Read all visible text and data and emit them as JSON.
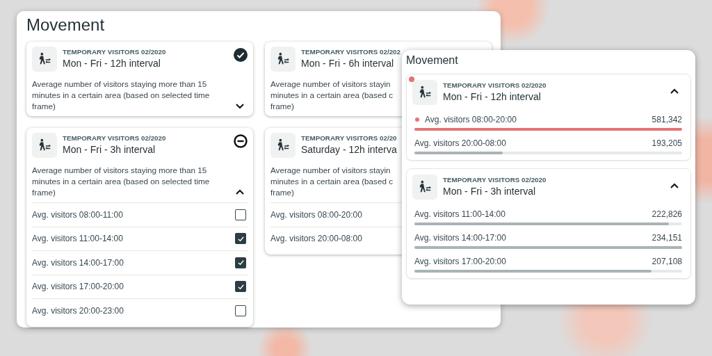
{
  "main_panel": {
    "title": "Movement",
    "columns": [
      [
        {
          "overline": "TEMPORARY VISITORS 02/2020",
          "title": "Mon - Fri - 12h interval",
          "checked": true,
          "description": "Average number of visitors staying more than 15\nminutes in a certain area (based on selected time\nframe)",
          "expanded": false
        },
        {
          "overline": "TEMPORARY VISITORS 02/2020",
          "title": "Mon - Fri - 3h interval",
          "indeterminate": true,
          "description": "Average number of visitors staying more than 15\nminutes in a certain area (based on selected time\nframe)",
          "expanded": true,
          "rows": [
            {
              "label": "Avg. visitors 08:00-11:00",
              "checked": false
            },
            {
              "label": "Avg. visitors 11:00-14:00",
              "checked": true
            },
            {
              "label": "Avg. visitors 14:00-17:00",
              "checked": true
            },
            {
              "label": "Avg. visitors 17:00-20:00",
              "checked": true
            },
            {
              "label": "Avg. visitors 20:00-23:00",
              "checked": false
            }
          ]
        }
      ],
      [
        {
          "overline": "TEMPORARY VISITORS 02/202",
          "title": "Mon - Fri - 6h interval",
          "description": "Average number of visitors stayin\nminutes in a certain area (based c\nframe)"
        },
        {
          "overline": "TEMPORARY VISITORS 02/20",
          "title": "Saturday - 12h interva",
          "description": "Average number of visitors stayin\nminutes in a certain area (based c\nframe)",
          "rows": [
            {
              "label": "Avg. visitors 08:00-20:00"
            },
            {
              "label": "Avg. visitors 20:00-08:00"
            }
          ]
        }
      ]
    ]
  },
  "overlay_panel": {
    "title": "Movement",
    "cards": [
      {
        "overline": "TEMPORARY VISITORS 02/2020",
        "title": "Mon - Fri - 12h interval",
        "color": "#e57373",
        "expanded": true,
        "rows": [
          {
            "label": "Avg. visitors 08:00-20:00",
            "value": "581,342",
            "level": 1.0,
            "color": "#e57373"
          },
          {
            "label": "Avg. visitors 20:00-08:00",
            "value": "193,205",
            "level": 0.33
          }
        ]
      },
      {
        "overline": "TEMPORARY VISITORS 02/2020",
        "title": "Mon - Fri - 3h interval",
        "expanded": true,
        "rows": [
          {
            "label": "Avg. visitors 11:00-14:00",
            "value": "222,826",
            "level": 0.95
          },
          {
            "label": "Avg. visitors 14:00-17:00",
            "value": "234,151",
            "level": 1.0
          },
          {
            "label": "Avg. visitors 17:00-20:00",
            "value": "207,108",
            "level": 0.885
          }
        ]
      }
    ]
  }
}
